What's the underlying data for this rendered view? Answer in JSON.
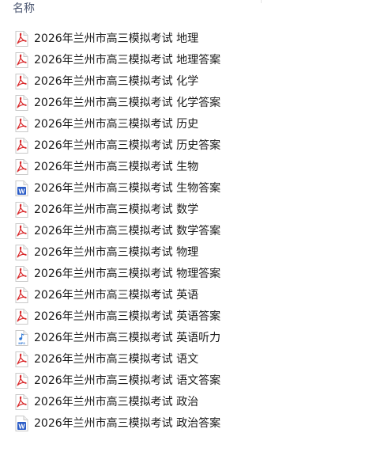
{
  "header": {
    "name_column_label": "名称"
  },
  "colors": {
    "pdf_red": "#d9292b",
    "word_blue": "#2b5cc7",
    "audio_blue": "#2f78d6"
  },
  "files": [
    {
      "name": "2026年兰州市高三模拟考试 地理",
      "icon": "pdf-icon"
    },
    {
      "name": "2026年兰州市高三模拟考试 地理答案",
      "icon": "pdf-icon"
    },
    {
      "name": "2026年兰州市高三模拟考试 化学",
      "icon": "pdf-icon"
    },
    {
      "name": "2026年兰州市高三模拟考试 化学答案",
      "icon": "pdf-icon"
    },
    {
      "name": "2026年兰州市高三模拟考试 历史",
      "icon": "pdf-icon"
    },
    {
      "name": "2026年兰州市高三模拟考试 历史答案",
      "icon": "pdf-icon"
    },
    {
      "name": "2026年兰州市高三模拟考试 生物",
      "icon": "pdf-icon"
    },
    {
      "name": "2026年兰州市高三模拟考试 生物答案",
      "icon": "word-doc-icon"
    },
    {
      "name": "2026年兰州市高三模拟考试 数学",
      "icon": "pdf-icon"
    },
    {
      "name": "2026年兰州市高三模拟考试 数学答案",
      "icon": "pdf-icon"
    },
    {
      "name": "2026年兰州市高三模拟考试 物理",
      "icon": "pdf-icon"
    },
    {
      "name": "2026年兰州市高三模拟考试 物理答案",
      "icon": "pdf-icon"
    },
    {
      "name": "2026年兰州市高三模拟考试 英语",
      "icon": "pdf-icon"
    },
    {
      "name": "2026年兰州市高三模拟考试 英语答案",
      "icon": "pdf-icon"
    },
    {
      "name": "2026年兰州市高三模拟考试 英语听力",
      "icon": "mp3-audio-icon",
      "icon_text": "MP3"
    },
    {
      "name": "2026年兰州市高三模拟考试 语文",
      "icon": "pdf-icon"
    },
    {
      "name": "2026年兰州市高三模拟考试 语文答案",
      "icon": "pdf-icon"
    },
    {
      "name": "2026年兰州市高三模拟考试 政治",
      "icon": "pdf-icon"
    },
    {
      "name": "2026年兰州市高三模拟考试 政治答案",
      "icon": "word-doc-icon",
      "icon_text": "W"
    }
  ]
}
